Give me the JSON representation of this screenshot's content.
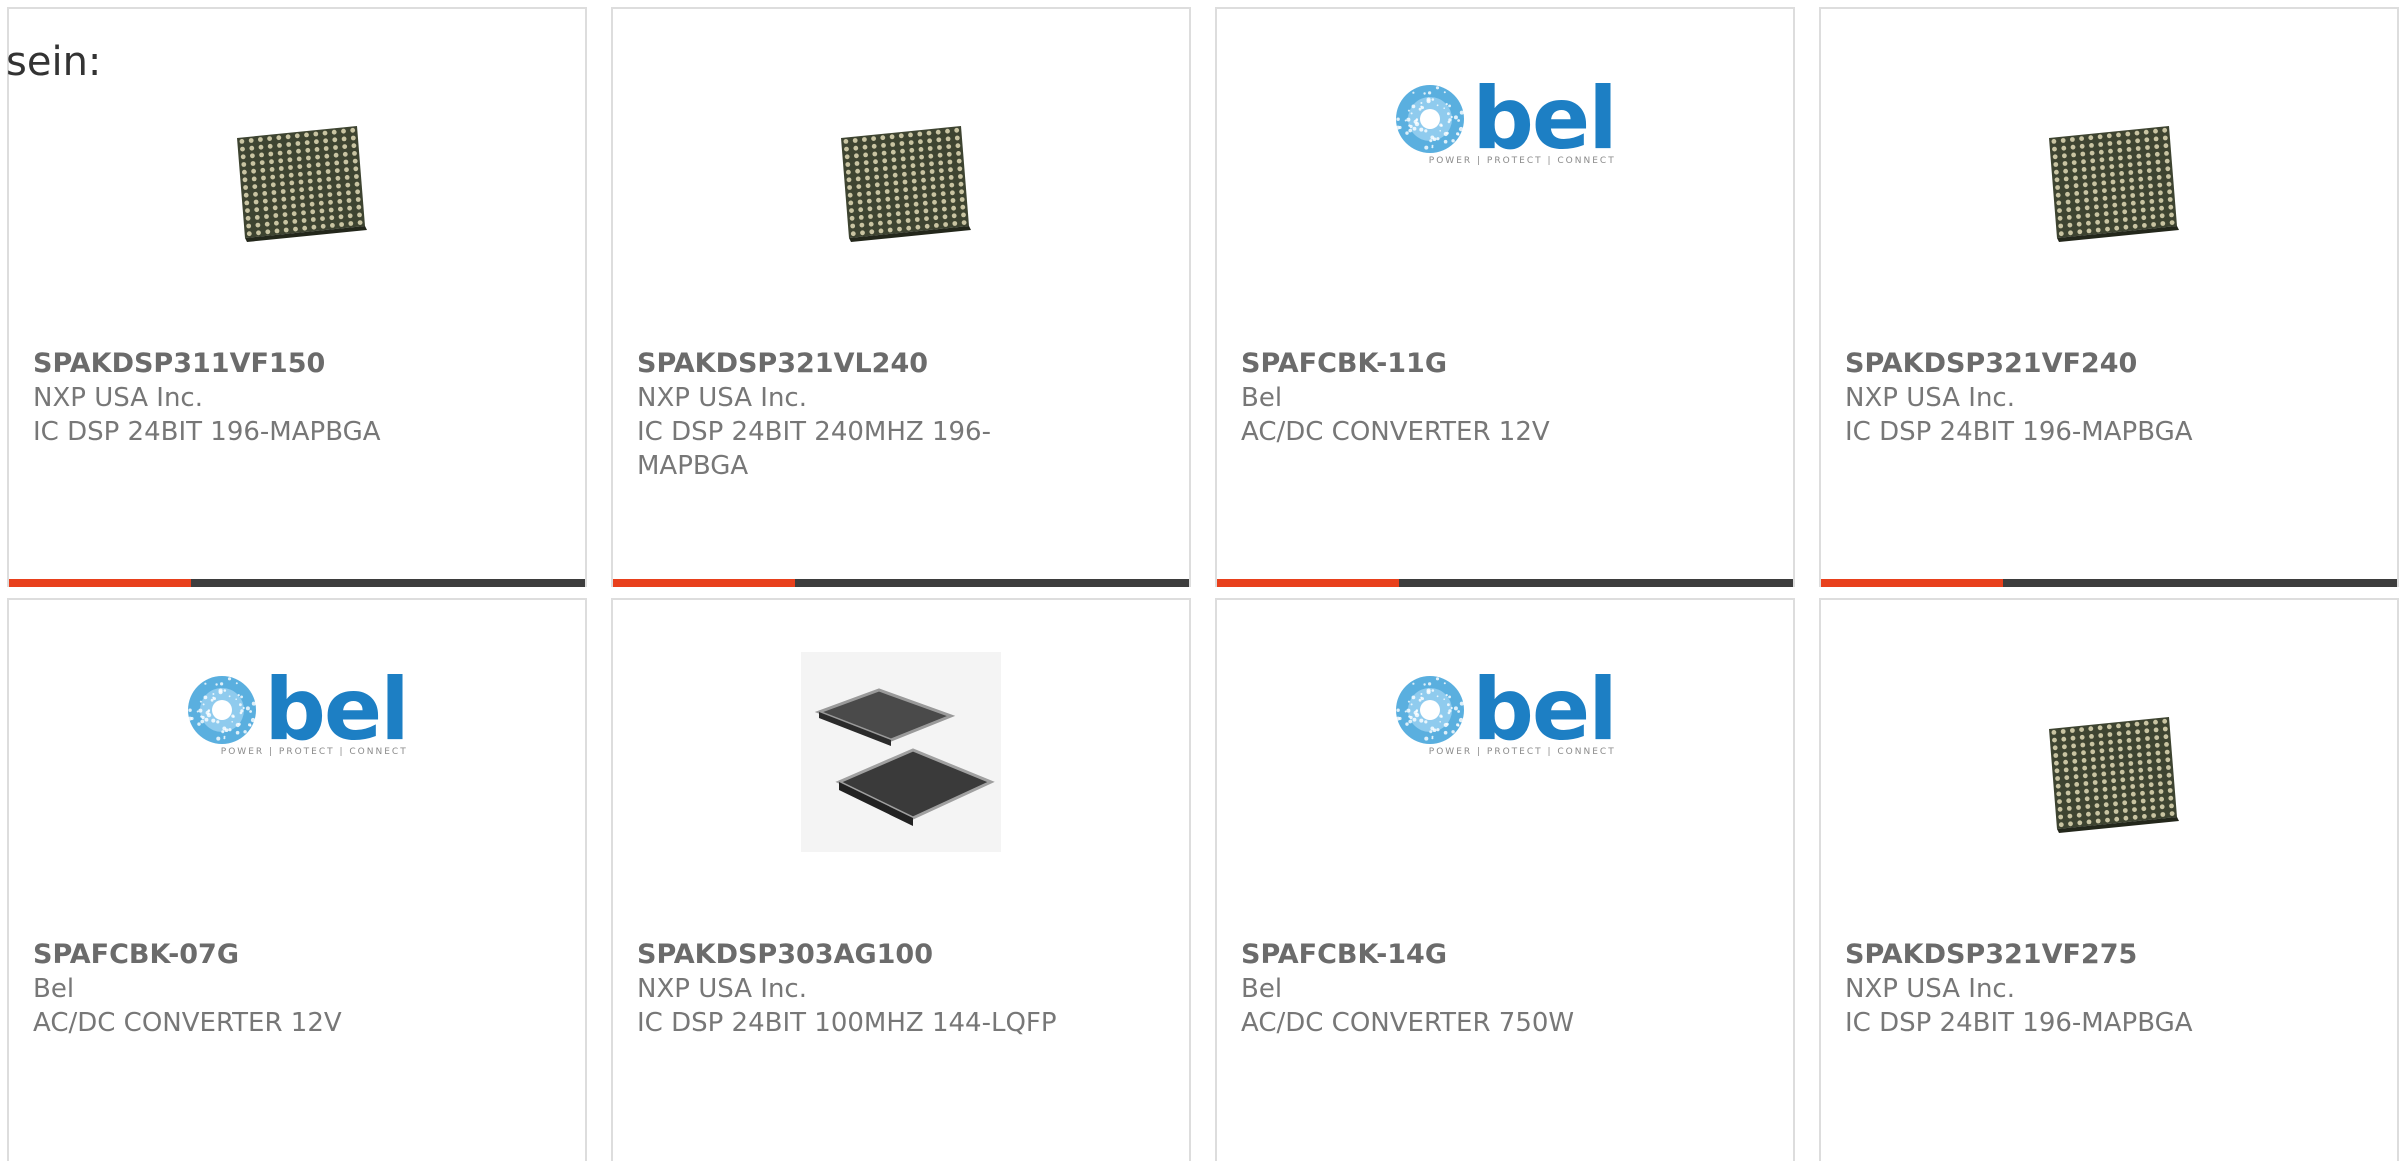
{
  "intro_text": "sein:",
  "colors": {
    "accent_bar": "#e8401c",
    "bar_base": "#3d3d3d",
    "bel_blue": "#1d7fc4",
    "card_border": "#dddddd"
  },
  "products": [
    {
      "part_number": "SPAKDSP311VF150",
      "manufacturer": "NXP USA Inc.",
      "description": "IC DSP 24BIT 196-MAPBGA",
      "image": "bga-chip-icon"
    },
    {
      "part_number": "SPAKDSP321VL240",
      "manufacturer": "NXP USA Inc.",
      "description": "IC DSP 24BIT 240MHZ 196-MAPBGA",
      "image": "bga-chip-icon"
    },
    {
      "part_number": "SPAFCBK-11G",
      "manufacturer": "Bel",
      "description": "AC/DC CONVERTER 12V",
      "image": "bel-logo"
    },
    {
      "part_number": "SPAKDSP321VF240",
      "manufacturer": "NXP USA Inc.",
      "description": "IC DSP 24BIT 196-MAPBGA",
      "image": "bga-chip-icon"
    },
    {
      "part_number": "SPAFCBK-07G",
      "manufacturer": "Bel",
      "description": "AC/DC CONVERTER 12V",
      "image": "bel-logo"
    },
    {
      "part_number": "SPAKDSP303AG100",
      "manufacturer": "NXP USA Inc.",
      "description": "IC DSP 24BIT 100MHZ 144-LQFP",
      "image": "lqfp-chip-icon"
    },
    {
      "part_number": "SPAFCBK-14G",
      "manufacturer": "Bel",
      "description": "AC/DC CONVERTER 750W",
      "image": "bel-logo"
    },
    {
      "part_number": "SPAKDSP321VF275",
      "manufacturer": "NXP USA Inc.",
      "description": "IC DSP 24BIT 196-MAPBGA",
      "image": "bga-chip-icon"
    }
  ],
  "bel_logo": {
    "word": "bel",
    "tagline": "POWER | PROTECT | CONNECT"
  }
}
